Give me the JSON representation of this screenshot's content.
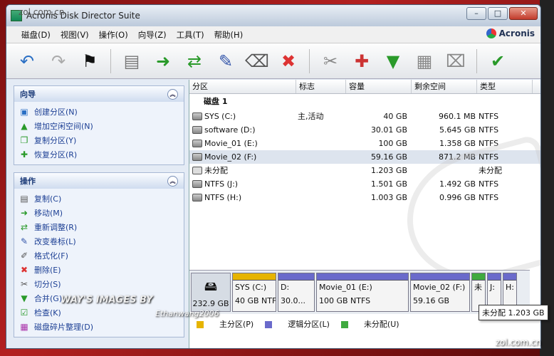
{
  "window": {
    "title": "Acronis Disk Director Suite",
    "watermark_top": "zol.com.cn"
  },
  "brand": "Acronis",
  "menu": [
    "磁盘(D)",
    "视图(V)",
    "操作(O)",
    "向导(Z)",
    "工具(T)",
    "帮助(H)"
  ],
  "toolbar": {
    "icons": [
      "undo-icon",
      "redo-icon",
      "commit-flag-icon",
      "create-partition-icon",
      "resize-icon",
      "move-icon",
      "change-label-icon",
      "format-icon",
      "delete-icon",
      "split-icon",
      "merge-icon",
      "check-icon",
      "defrag-icon",
      "clean-icon",
      "apply-icon"
    ]
  },
  "sidebar": {
    "wizards": {
      "title": "向导",
      "items": [
        {
          "label": "创建分区(N)",
          "icon": "create-partition-icon"
        },
        {
          "label": "增加空闲空间(N)",
          "icon": "add-space-icon"
        },
        {
          "label": "复制分区(Y)",
          "icon": "copy-partition-icon"
        },
        {
          "label": "恢复分区(R)",
          "icon": "recover-partition-icon"
        }
      ]
    },
    "operations": {
      "title": "操作",
      "items": [
        {
          "label": "复制(C)",
          "icon": "copy-icon"
        },
        {
          "label": "移动(M)",
          "icon": "move-icon"
        },
        {
          "label": "重新调整(R)",
          "icon": "resize-icon"
        },
        {
          "label": "改变卷标(L)",
          "icon": "label-icon"
        },
        {
          "label": "格式化(F)",
          "icon": "format-icon"
        },
        {
          "label": "删除(E)",
          "icon": "delete-icon"
        },
        {
          "label": "切分(S)",
          "icon": "split-icon"
        },
        {
          "label": "合并(G)",
          "icon": "merge-icon"
        },
        {
          "label": "检查(K)",
          "icon": "check-icon"
        },
        {
          "label": "磁盘碎片整理(D)",
          "icon": "defrag-icon"
        }
      ]
    }
  },
  "table": {
    "headers": [
      "分区",
      "标志",
      "容量",
      "剩余空间",
      "类型"
    ],
    "disk_label": "磁盘 1",
    "rows": [
      {
        "name": "SYS (C:)",
        "flag": "主,活动",
        "capacity": "40 GB",
        "free": "960.1 MB",
        "type": "NTFS"
      },
      {
        "name": "software (D:)",
        "flag": "",
        "capacity": "30.01 GB",
        "free": "5.645 GB",
        "type": "NTFS"
      },
      {
        "name": "Movie_01 (E:)",
        "flag": "",
        "capacity": "100 GB",
        "free": "1.358 GB",
        "type": "NTFS"
      },
      {
        "name": "Movie_02 (F:)",
        "flag": "",
        "capacity": "59.16 GB",
        "free": "871.2 MB",
        "type": "NTFS"
      },
      {
        "name": "未分配",
        "flag": "",
        "capacity": "1.203 GB",
        "free": "",
        "type": "未分配"
      },
      {
        "name": "NTFS (J:)",
        "flag": "",
        "capacity": "1.501 GB",
        "free": "1.492 GB",
        "type": "NTFS"
      },
      {
        "name": "NTFS (H:)",
        "flag": "",
        "capacity": "1.003 GB",
        "free": "0.996 GB",
        "type": "NTFS"
      }
    ]
  },
  "diskmap": {
    "disk_size": "232.9 GB",
    "segments": [
      {
        "line1": "SYS (C:)",
        "line2": "40 GB  NTFS",
        "color": "#e6b400"
      },
      {
        "line1": "D:",
        "line2": "30.0...",
        "color": "#6a6acb"
      },
      {
        "line1": "Movie_01 (E:)",
        "line2": "100 GB  NTFS",
        "color": "#6a6acb"
      },
      {
        "line1": "Movie_02 (F:)",
        "line2": "59.16 GB",
        "color": "#6a6acb"
      },
      {
        "line1": "未",
        "line2": "",
        "color": "#3faa3f"
      },
      {
        "line1": "J:",
        "line2": "",
        "color": "#6a6acb"
      },
      {
        "line1": "H:",
        "line2": "",
        "color": "#6a6acb"
      }
    ]
  },
  "legend": [
    {
      "label": "主分区(P)",
      "color": "#e6b400"
    },
    {
      "label": "逻辑分区(L)",
      "color": "#6a6acb"
    },
    {
      "label": "未分配(U)",
      "color": "#3faa3f"
    }
  ],
  "tooltip": "未分配 1.203 GB",
  "watermarks": {
    "w1": "WAY'S IMAGES BY",
    "w2": "Ethanwang2006",
    "w3": "zol.com.cn"
  }
}
